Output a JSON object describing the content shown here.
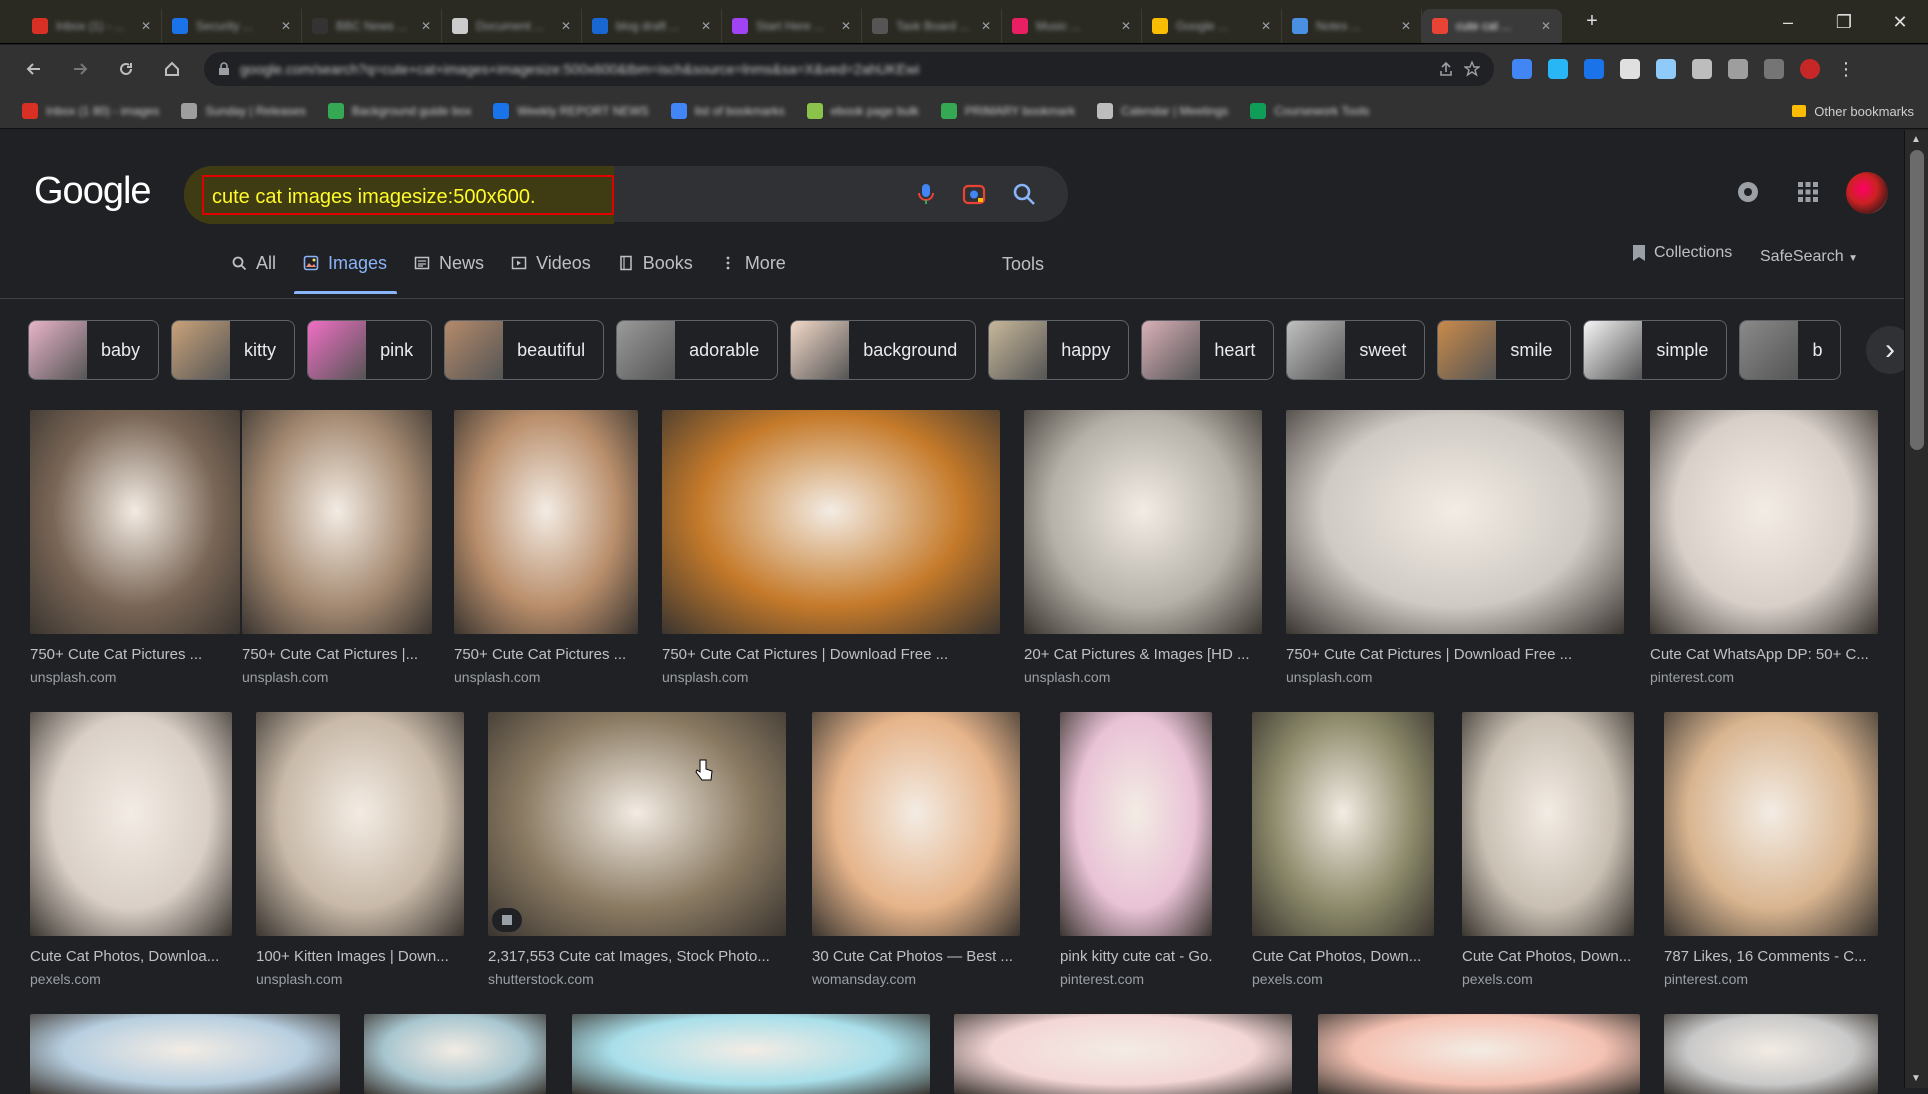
{
  "browser": {
    "tabs": [
      {
        "label": "Inbox (1) - ...",
        "color": "#d93025"
      },
      {
        "label": "Security ...",
        "color": "#1a73e8"
      },
      {
        "label": "BBC News ...",
        "color": "#333333"
      },
      {
        "label": "Document ...",
        "color": "#cccccc"
      },
      {
        "label": "blog draft ...",
        "color": "#1967d2"
      },
      {
        "label": "Start Here ...",
        "color": "#a142f4"
      },
      {
        "label": "Task Board ...",
        "color": "#555555"
      },
      {
        "label": "Music ...",
        "color": "#e91e63"
      },
      {
        "label": "Google ...",
        "color": "#fbbc04"
      },
      {
        "label": "Notes ...",
        "color": "#4a90e2"
      },
      {
        "label": "cute cat ...",
        "color": "#ea4335",
        "active": true
      }
    ],
    "new_tab_symbol": "+",
    "window_controls": {
      "minimize": "–",
      "maximize": "❐",
      "close": "✕"
    },
    "url": "google.com/search?q=cute+cat+images+imagesize:500x600&tbm=isch&source=lnms&sa=X&ved=2ahUKEwi",
    "bookmarks": [
      {
        "label": "Inbox (1 80) - images",
        "color": "#d93025"
      },
      {
        "label": "Sunday | Releases",
        "color": "#9e9e9e"
      },
      {
        "label": "Background guide box",
        "color": "#34a853"
      },
      {
        "label": "Weekly REPORT NEWS",
        "color": "#1a73e8"
      },
      {
        "label": "list of bookmarks",
        "color": "#4285f4"
      },
      {
        "label": "ebook page bulk",
        "color": "#8bc34a"
      },
      {
        "label": "PRIMARY bookmark",
        "color": "#34a853"
      },
      {
        "label": "Calendar | Meetings",
        "color": "#bdbdbd"
      },
      {
        "label": "Coursework Tools",
        "color": "#0f9d58"
      }
    ],
    "other_bookmarks": "Other bookmarks"
  },
  "google": {
    "logo": "Google",
    "query": "cute cat images imagesize:500x600.",
    "nav_tabs": [
      {
        "label": "All",
        "icon": "search-icon"
      },
      {
        "label": "Images",
        "icon": "image-icon",
        "active": true
      },
      {
        "label": "News",
        "icon": "news-icon"
      },
      {
        "label": "Videos",
        "icon": "video-icon"
      },
      {
        "label": "Books",
        "icon": "book-icon"
      },
      {
        "label": "More",
        "icon": "more-vert-icon"
      }
    ],
    "tools": "Tools",
    "collections": "Collections",
    "safesearch": "SafeSearch",
    "chips": [
      {
        "label": "baby",
        "color": "#e8b4c8"
      },
      {
        "label": "kitty",
        "color": "#c9a27a"
      },
      {
        "label": "pink",
        "color": "#f06fc4"
      },
      {
        "label": "beautiful",
        "color": "#b48a6a"
      },
      {
        "label": "adorable",
        "color": "#9a9a9a"
      },
      {
        "label": "background",
        "color": "#f2d9c8"
      },
      {
        "label": "happy",
        "color": "#c8b89a"
      },
      {
        "label": "heart",
        "color": "#d9b0b8"
      },
      {
        "label": "sweet",
        "color": "#c0c0c0"
      },
      {
        "label": "smile",
        "color": "#c98a4a"
      },
      {
        "label": "simple",
        "color": "#f5f5f5"
      },
      {
        "label": "b",
        "color": "#8a8a8a"
      }
    ],
    "results_row1": [
      {
        "title": "750+ Cute Cat Pictures ...",
        "site": "unsplash.com",
        "color": "#7a6656"
      },
      {
        "title": "750+ Cute Cat Pictures |...",
        "site": "unsplash.com",
        "color": "#a58a72"
      },
      {
        "title": "750+ Cute Cat Pictures ...",
        "site": "unsplash.com",
        "color": "#b98e6b"
      },
      {
        "title": "750+ Cute Cat Pictures | Download Free ...",
        "site": "unsplash.com",
        "color": "#c57a2a"
      },
      {
        "title": "20+ Cat Pictures & Images [HD ...",
        "site": "unsplash.com",
        "color": "#b5b1a8"
      },
      {
        "title": "750+ Cute Cat Pictures | Download Free ...",
        "site": "unsplash.com",
        "color": "#cfcac4"
      },
      {
        "title": "Cute Cat WhatsApp DP: 50+ C...",
        "site": "pinterest.com",
        "color": "#d8cfc9"
      }
    ],
    "results_row2": [
      {
        "title": "Cute Cat Photos, Downloa...",
        "site": "pexels.com",
        "color": "#d9cfc6"
      },
      {
        "title": "100+ Kitten Images | Down...",
        "site": "unsplash.com",
        "color": "#c8b9a8"
      },
      {
        "title": "2,317,553 Cute cat Images, Stock Photo...",
        "site": "shutterstock.com",
        "color": "#8a7a62"
      },
      {
        "title": "30 Cute Cat Photos — Best ...",
        "site": "womansday.com",
        "color": "#e6b48a"
      },
      {
        "title": "pink kitty cute cat - Go...",
        "site": "pinterest.com",
        "color": "#e9c2d6"
      },
      {
        "title": "Cute Cat Photos, Down...",
        "site": "pexels.com",
        "color": "#8c8a6a"
      },
      {
        "title": "Cute Cat Photos, Down...",
        "site": "pexels.com",
        "color": "#c9c0b3"
      },
      {
        "title": "787 Likes, 16 Comments - C...",
        "site": "pinterest.com",
        "color": "#d9b590"
      }
    ],
    "results_row3": [
      {
        "color": "#b8cfe0"
      },
      {
        "color": "#a8c6cf"
      },
      {
        "color": "#a9dfea"
      },
      {
        "color": "#f3d6d6"
      },
      {
        "color": "#f4c2b3"
      },
      {
        "color": "#c9c9c9"
      }
    ]
  }
}
